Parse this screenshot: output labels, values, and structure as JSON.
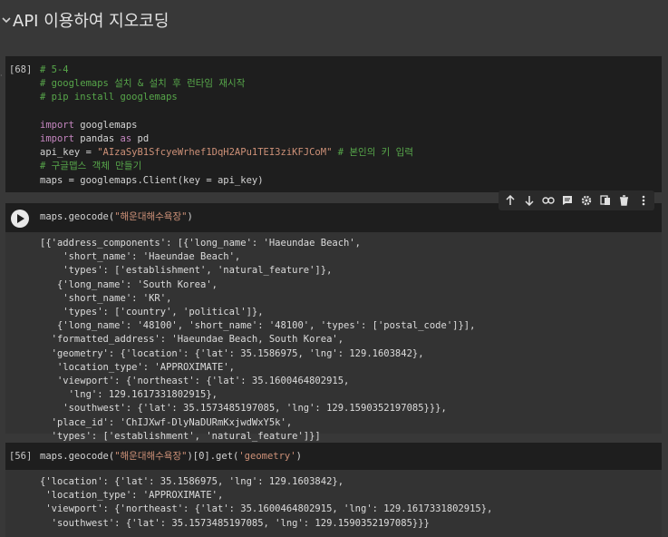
{
  "section": {
    "title": "API 이용하여 지오코딩"
  },
  "cell1": {
    "exec_count": "[68]",
    "lines": [
      [
        {
          "t": "cm",
          "v": "# 5-4"
        }
      ],
      [
        {
          "t": "cm",
          "v": "# googlemaps 설치 & 설치 후 런타임 재시작"
        }
      ],
      [
        {
          "t": "cm",
          "v": "# pip install googlemaps"
        }
      ],
      [
        {
          "t": "pl",
          "v": ""
        }
      ],
      [
        {
          "t": "kw",
          "v": "import"
        },
        {
          "t": "pl",
          "v": " googlemaps"
        }
      ],
      [
        {
          "t": "kw",
          "v": "import"
        },
        {
          "t": "pl",
          "v": " pandas "
        },
        {
          "t": "kw",
          "v": "as"
        },
        {
          "t": "pl",
          "v": " pd"
        }
      ],
      [
        {
          "t": "pl",
          "v": "api_key = "
        },
        {
          "t": "st",
          "v": "\"AIzaSyB1SfcyeWrhef1DqH2APu1TEI3ziKFJCoM\""
        },
        {
          "t": "pl",
          "v": " "
        },
        {
          "t": "cm",
          "v": "# 본인의 키 입력"
        }
      ],
      [
        {
          "t": "cm",
          "v": "# 구글맵스 객체 만들기"
        }
      ],
      [
        {
          "t": "pl",
          "v": "maps = googlemaps.Client(key = api_key)"
        }
      ]
    ]
  },
  "cell2": {
    "code": [
      {
        "t": "pl",
        "v": "maps.geocode("
      },
      {
        "t": "st",
        "v": "\"해운대해수욕장\""
      },
      {
        "t": "pl",
        "v": ")"
      }
    ],
    "output_lines": [
      "[{'address_components': [{'long_name': 'Haeundae Beach',",
      "    'short_name': 'Haeundae Beach',",
      "    'types': ['establishment', 'natural_feature']},",
      "   {'long_name': 'South Korea',",
      "    'short_name': 'KR',",
      "    'types': ['country', 'political']},",
      "   {'long_name': '48100', 'short_name': '48100', 'types': ['postal_code']}],",
      "  'formatted_address': 'Haeundae Beach, South Korea',",
      "  'geometry': {'location': {'lat': 35.1586975, 'lng': 129.1603842},",
      "   'location_type': 'APPROXIMATE',",
      "   'viewport': {'northeast': {'lat': 35.1600464802915,",
      "     'lng': 129.1617331802915},",
      "    'southwest': {'lat': 35.1573485197085, 'lng': 129.1590352197085}}},",
      "  'place_id': 'ChIJXwf-DlyNaDURmKxjwdWxY5k',",
      "  'types': ['establishment', 'natural_feature']}]"
    ]
  },
  "cell3": {
    "exec_count": "[56]",
    "code": [
      {
        "t": "pl",
        "v": "maps.geocode("
      },
      {
        "t": "st",
        "v": "\"해운대해수욕장\""
      },
      {
        "t": "pl",
        "v": ")[0].get("
      },
      {
        "t": "st",
        "v": "'geometry'"
      },
      {
        "t": "pl",
        "v": ")"
      }
    ],
    "output_lines": [
      "{'location': {'lat': 35.1586975, 'lng': 129.1603842},",
      " 'location_type': 'APPROXIMATE',",
      " 'viewport': {'northeast': {'lat': 35.1600464802915, 'lng': 129.1617331802915},",
      "  'southwest': {'lat': 35.1573485197085, 'lng': 129.1590352197085}}}"
    ]
  },
  "toolbar": {
    "icons": [
      "arrow-up-icon",
      "arrow-down-icon",
      "link-icon",
      "comment-icon",
      "gear-icon",
      "mirror-icon",
      "trash-icon",
      "more-vert-icon"
    ]
  },
  "colors": {
    "comment": "#57a64a",
    "keyword": "#c586c0",
    "string": "#ce9178",
    "cell_bg": "#1e1e1e",
    "page_bg": "#383838"
  }
}
